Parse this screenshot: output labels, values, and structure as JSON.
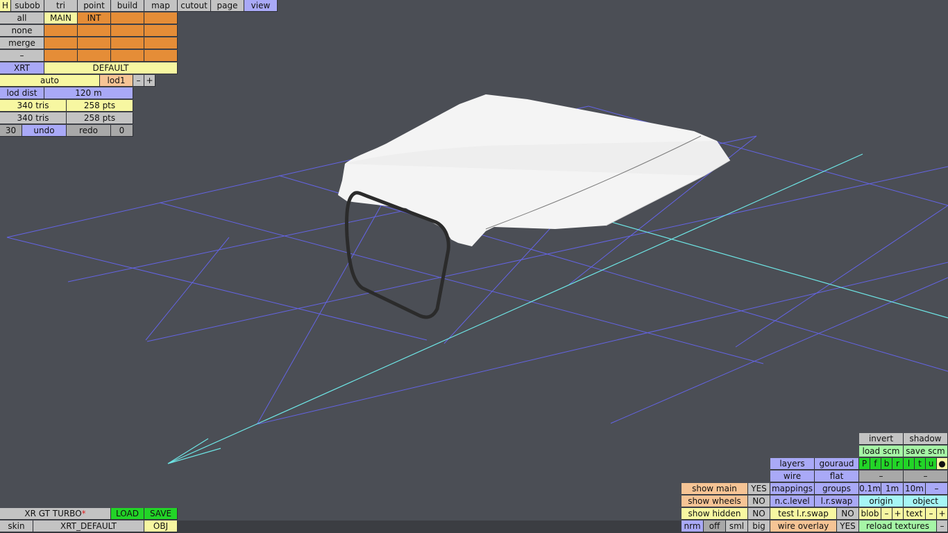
{
  "menu": {
    "h": "H",
    "tabs": [
      "subob",
      "tri",
      "point",
      "build",
      "map",
      "cutout",
      "page",
      "view"
    ]
  },
  "select": {
    "all": "all",
    "none": "none",
    "merge": "merge",
    "dash": "–",
    "main": "MAIN",
    "int": "INT"
  },
  "car": {
    "code": "XRT",
    "config": "DEFAULT"
  },
  "lod": {
    "mode": "auto",
    "level": "lod1",
    "minus": "–",
    "plus": "+",
    "dist_label": "lod dist",
    "dist_value": "120 m"
  },
  "stats": {
    "tris_1": "340 tris",
    "pts_1": "258 pts",
    "tris_2": "340 tris",
    "pts_2": "258 pts"
  },
  "history": {
    "count": "30",
    "undo": "undo",
    "redo": "redo",
    "redo_count": "0"
  },
  "file": {
    "name": "XR GT TURBO",
    "modified_mark": "*",
    "load": "LOAD",
    "save": "SAVE",
    "skin": "skin",
    "skin_name": "XRT_DEFAULT",
    "obj": "OBJ"
  },
  "view": {
    "invert": "invert",
    "shadow": "shadow",
    "load_scm": "load scm",
    "save_scm": "save scm",
    "views": [
      "P",
      "f",
      "b",
      "r",
      "l",
      "t",
      "u"
    ],
    "dot": "●",
    "layers": "layers",
    "gouraud": "gouraud",
    "wire": "wire",
    "flat": "flat",
    "dash1": "–",
    "dash2": "–",
    "show_main": "show main",
    "show_main_val": "YES",
    "mappings": "mappings",
    "groups": "groups",
    "grid_sizes": [
      "0.1m",
      "1m",
      "10m"
    ],
    "grid_minus": "–",
    "show_wheels": "show wheels",
    "show_wheels_val": "NO",
    "nc_level": "n.c.level",
    "lr_swap": "l.r.swap",
    "origin": "origin",
    "object": "object",
    "show_hidden": "show hidden",
    "show_hidden_val": "NO",
    "test_lr_swap": "test l.r.swap",
    "test_lr_swap_val": "NO",
    "blob": "blob",
    "blob_minus": "–",
    "blob_plus": "+",
    "text": "text",
    "text_minus": "–",
    "text_plus": "+",
    "sizes": [
      "nrm",
      "off",
      "sml",
      "big"
    ],
    "wire_overlay": "wire overlay",
    "wire_overlay_val": "YES",
    "reload_textures": "reload textures",
    "reload_minus": "–"
  },
  "colors": {
    "background": "#4b4e55",
    "grid": "#6464e6",
    "axis": "#6ee6e6",
    "button_gray": "#c3c3c3",
    "button_blue": "#a9a9f7",
    "button_orange": "#e58d37",
    "button_yellow": "#f7f7a1",
    "button_green": "#22d427",
    "model_white": "#f4f4f4"
  }
}
